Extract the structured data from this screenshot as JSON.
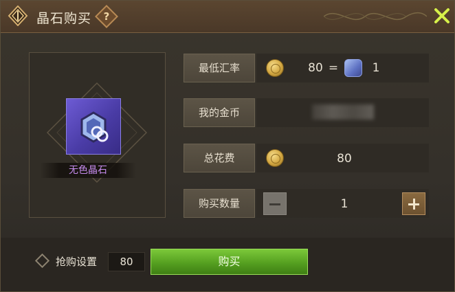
{
  "dialog": {
    "title": "晶石购买",
    "help_label": "?"
  },
  "item": {
    "name": "无色晶石"
  },
  "rows": {
    "rate": {
      "label": "最低汇率",
      "coin_amount": "80",
      "equals": "=",
      "gem_amount": "1"
    },
    "gold": {
      "label": "我的金币",
      "value": ""
    },
    "total": {
      "label": "总花费",
      "value": "80"
    },
    "quantity": {
      "label": "购买数量",
      "value": "1"
    }
  },
  "footer": {
    "setting_label": "抢购设置",
    "price_value": "80",
    "buy_label": "购买"
  },
  "colors": {
    "accent_green": "#55a020",
    "item_name_purple": "#c78cf0",
    "close_icon": "#d6f04a"
  },
  "icons": {
    "title_emblem": "crystal-emblem-icon",
    "coin": "gold-coin-icon",
    "gem": "crystal-gem-icon",
    "close": "close-icon"
  }
}
